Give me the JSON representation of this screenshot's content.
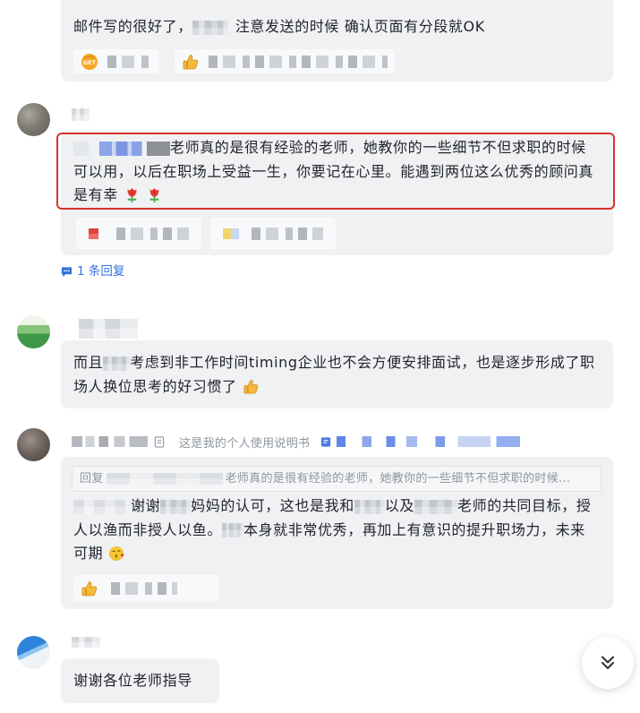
{
  "colors": {
    "bubble_bg": "#f0f1f3",
    "reaction_bg": "#f8f9fa",
    "text": "#1f2329",
    "secondary_text": "#8f959e",
    "link": "#3370e0",
    "highlight_border": "#d8352a",
    "quote_border": "#dfe1e5"
  },
  "messages": [
    {
      "text_parts": [
        "邮件写的很好了，",
        "注意发送的时候 确认页面有分段就OK"
      ],
      "reactions": [
        {
          "emoji": "get-emoji",
          "emoji_text": "GET"
        },
        {
          "emoji": "thumbs-up"
        }
      ]
    },
    {
      "text": "老师真的是很有经验的老师，她教你的一些细节不但求职的时候可以用，以后在职场上受益一生，你要记在心里。能遇到两位这么优秀的顾问真是有幸",
      "trailing_emoji": [
        "rose",
        "rose"
      ],
      "reply_count_label": "1 条回复"
    },
    {
      "text_parts": [
        "而且",
        "考虑到非工作时间timing企业也不会方便安排面试，也是逐步形成了职场人换位思考的好习惯了"
      ],
      "trailing_emoji": [
        "thumbs-up"
      ]
    },
    {
      "signature": "这是我的个人使用说明书",
      "quote": {
        "prefix": "回复",
        "text": "老师真的是很有经验的老师，她教你的一些细节不但求职的时候..."
      },
      "text_parts": [
        "谢谢",
        "妈妈的认可，这也是我和",
        "以及",
        "老师的共同目标，授人以渔而非授人以鱼。",
        "本身就非常优秀，再加上有意识的提升职场力，未来可期"
      ],
      "trailing_emoji": [
        "blowing-kiss"
      ],
      "reactions": [
        {
          "emoji": "thumbs-up"
        }
      ]
    },
    {
      "text": "谢谢各位老师指导"
    }
  ],
  "scroll_button": {
    "icon": "double-chevron-down"
  }
}
